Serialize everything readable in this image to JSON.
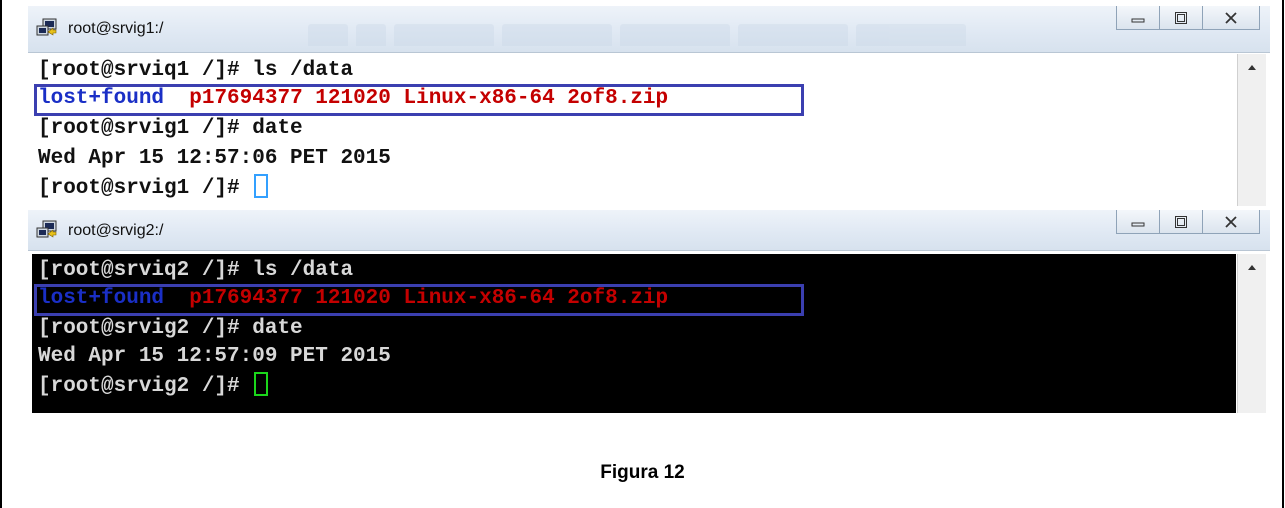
{
  "windows": [
    {
      "title": "root@srvig1:/",
      "lines": {
        "cmd1": "[root@srviq1 /]# ls /data",
        "dir": "lost+found",
        "file": "p17694377 121020 Linux-x86-64 2of8.zip",
        "cmd2": "[root@srvig1 /]# date",
        "date": "Wed Apr 15 12:57:06 PET 2015",
        "prompt": "[root@srvig1 /]# "
      }
    },
    {
      "title": "root@srvig2:/",
      "lines": {
        "cmd1": "[root@srviq2 /]# ls /data",
        "dir": "lost+found",
        "file": "p17694377 121020 Linux-x86-64 2of8.zip",
        "cmd2": "[root@srvig2 /]# date",
        "date": "Wed Apr 15 12:57:09 PET 2015",
        "prompt": "[root@srvig2 /]# "
      }
    }
  ],
  "icons": {
    "app": "putty-icon",
    "minimize": "minimize-icon",
    "maximize": "maximize-icon",
    "close": "close-icon",
    "scroll_up": "scroll-up-arrow-icon"
  },
  "colors": {
    "highlight_box": "#3b3fb0",
    "file_text": "#c40000",
    "dir_text": "#1a2fc6",
    "cursor_win1": "#33a0ff",
    "cursor_win2": "#1bd61b"
  },
  "caption": "Figura 12"
}
